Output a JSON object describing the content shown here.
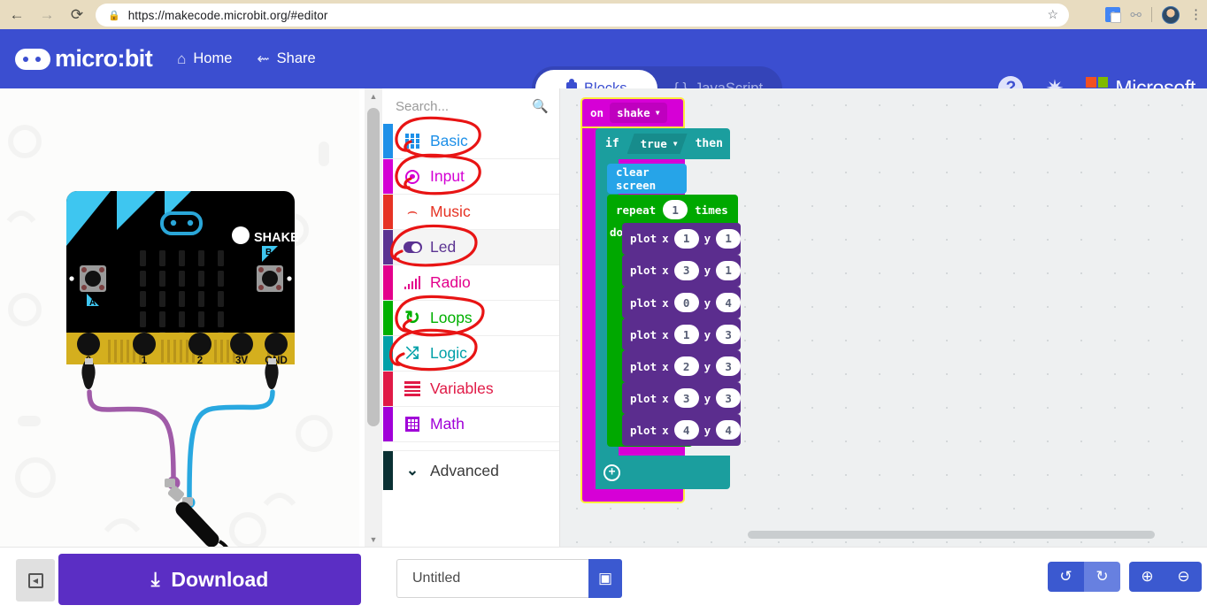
{
  "browser": {
    "back_icon": "back-arrow",
    "forward_icon": "forward-arrow",
    "reload_icon": "reload",
    "lock_icon": "lock",
    "url": "https://makecode.microbit.org/#editor",
    "star_icon": "bookmark-star",
    "translate_icon": "google-translate",
    "extensions_icon": "extensions",
    "avatar_icon": "profile-avatar",
    "menu_icon": "three-dot-menu"
  },
  "header": {
    "brand": "micro:bit",
    "home_label": "Home",
    "home_icon": "home-icon",
    "share_label": "Share",
    "share_icon": "share-icon",
    "toggle": {
      "blocks_label": "Blocks",
      "blocks_icon": "puzzle-piece-icon",
      "javascript_label": "JavaScript",
      "javascript_icon": "curly-braces",
      "active": "Blocks"
    },
    "help_icon": "question-mark-icon",
    "settings_icon": "gear-icon",
    "microsoft_label": "Microsoft",
    "microsoft_colors": [
      "#f25022",
      "#7fba00",
      "#00a4ef",
      "#ffb900"
    ],
    "bg_color": "#3b4ed0"
  },
  "simulator": {
    "board_label_shake": "SHAKE",
    "button_a": "A",
    "button_b": "B",
    "pins": [
      "0",
      "1",
      "2",
      "3V",
      "GND"
    ],
    "accessory": "headphone-jack",
    "wire_pin0_color": "#a05ba8",
    "wire_gnd_color": "#29a8e0"
  },
  "toolbox": {
    "search_placeholder": "Search...",
    "search_icon": "magnifier-icon",
    "categories": [
      {
        "label": "Basic",
        "color": "#1e90e8",
        "icon": "grid-icon",
        "annotated": true,
        "selected": false
      },
      {
        "label": "Input",
        "color": "#d400d4",
        "icon": "target-icon",
        "annotated": true,
        "selected": false
      },
      {
        "label": "Music",
        "color": "#e63324",
        "icon": "headphone-icon",
        "annotated": false,
        "selected": false
      },
      {
        "label": "Led",
        "color": "#5b3392",
        "icon": "toggle-icon",
        "annotated": true,
        "selected": true
      },
      {
        "label": "Radio",
        "color": "#e3008c",
        "icon": "signal-icon",
        "annotated": false,
        "selected": false
      },
      {
        "label": "Loops",
        "color": "#00b000",
        "icon": "refresh-icon",
        "annotated": true,
        "selected": false
      },
      {
        "label": "Logic",
        "color": "#00a0a8",
        "icon": "shuffle-icon",
        "annotated": true,
        "selected": false
      },
      {
        "label": "Variables",
        "color": "#e01a46",
        "icon": "lines-icon",
        "annotated": false,
        "selected": false
      },
      {
        "label": "Math",
        "color": "#a000d8",
        "icon": "calculator-icon",
        "annotated": false,
        "selected": false
      }
    ],
    "advanced": {
      "label": "Advanced",
      "icon": "chevron-down-icon",
      "color": "#0a3033"
    }
  },
  "workspace": {
    "blocks": {
      "event": {
        "prefix": "on",
        "dropdown": "shake",
        "dropdown_arrow": "▾",
        "color": "#d600d6",
        "selected": true
      },
      "if": {
        "if_label": "if",
        "condition": "true",
        "condition_arrow": "▾",
        "then_label": "then",
        "color": "#1b9e9e",
        "add_icon": "plus-circle-icon"
      },
      "clear": {
        "label": "clear screen",
        "color": "#26a4e8"
      },
      "repeat": {
        "prefix": "repeat",
        "count": "1",
        "suffix": "times",
        "do_label": "do",
        "color": "#00a800"
      },
      "plot_color": "#5b2d8e",
      "plot_label": "plot",
      "plot_x_label": "x",
      "plot_y_label": "y",
      "plots": [
        {
          "x": "1",
          "y": "1"
        },
        {
          "x": "3",
          "y": "1"
        },
        {
          "x": "0",
          "y": "4"
        },
        {
          "x": "1",
          "y": "3"
        },
        {
          "x": "2",
          "y": "3"
        },
        {
          "x": "3",
          "y": "3"
        },
        {
          "x": "4",
          "y": "4"
        }
      ]
    }
  },
  "bottom": {
    "collapse_icon": "collapse-simulator-icon",
    "download_label": "Download",
    "download_icon": "download-icon",
    "project_name": "Untitled",
    "save_icon": "floppy-disk-icon",
    "undo_icon": "undo-arrow-icon",
    "redo_icon": "redo-arrow-icon",
    "zoom_in_icon": "zoom-in-icon",
    "zoom_out_icon": "zoom-out-icon",
    "accent_color": "#3b59d0",
    "download_color": "#5b2ec4"
  }
}
